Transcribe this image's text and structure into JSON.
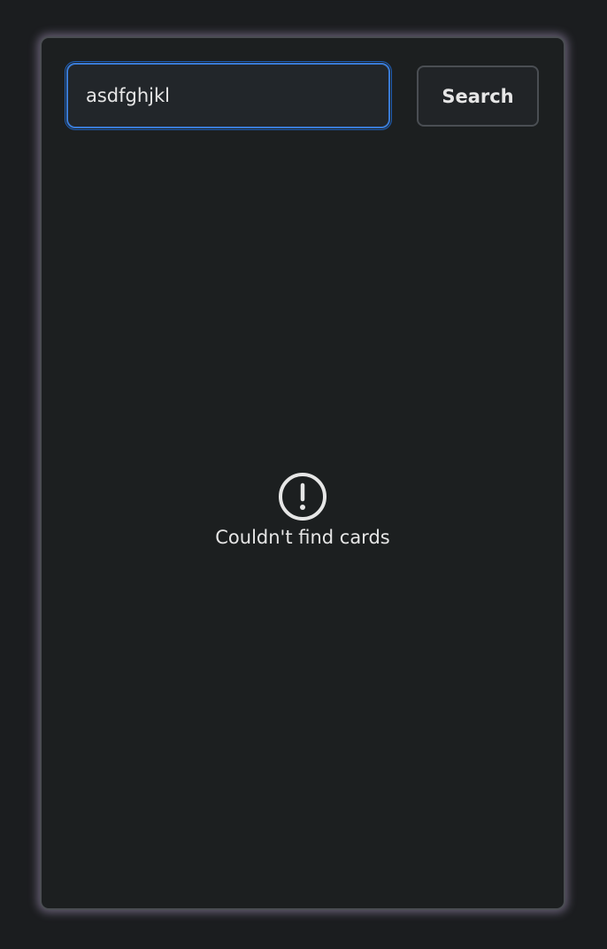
{
  "search": {
    "value": "asdfghjkl",
    "button_label": "Search"
  },
  "empty_state": {
    "icon": "alert-circle-icon",
    "message": "Couldn't find cards"
  },
  "colors": {
    "background": "#1b1d1f",
    "panel": "#1c1f20",
    "focus_border": "#3a7bd5",
    "text": "#e6e6e6"
  }
}
